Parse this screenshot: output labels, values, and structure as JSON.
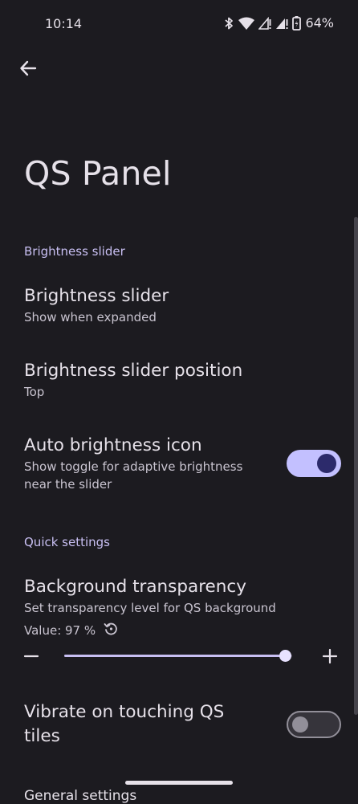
{
  "status_bar": {
    "time": "10:14",
    "battery": "64%",
    "icons": [
      "bluetooth-icon",
      "wifi-icon",
      "signal-icon",
      "signal-icon",
      "battery-charging-icon"
    ]
  },
  "header": {
    "back_icon": "arrow-left-icon",
    "title": "QS Panel"
  },
  "sections": {
    "brightness": {
      "header": "Brightness slider",
      "slider_pref": {
        "title": "Brightness slider",
        "summary": "Show when expanded"
      },
      "position_pref": {
        "title": "Brightness slider position",
        "summary": "Top"
      },
      "auto_icon_pref": {
        "title": "Auto brightness icon",
        "summary": "Show toggle for adaptive brightness near the slider",
        "enabled": true
      }
    },
    "quick_settings": {
      "header": "Quick settings",
      "transparency_pref": {
        "title": "Background transparency",
        "summary": "Set transparency level for QS background",
        "value_text": "Value: 97 %",
        "value": 97,
        "min": 0,
        "max": 100,
        "reset_icon": "reset-icon",
        "minus_icon": "minus-icon",
        "plus_icon": "plus-icon"
      },
      "vibrate_pref": {
        "title": "Vibrate on touching QS tiles",
        "enabled": false
      }
    },
    "cut_off_header": "General settings"
  },
  "colors": {
    "background": "#1c1b20",
    "accent": "#c8bff2",
    "switch_on_track": "#c3c0ff",
    "switch_on_thumb": "#2c2a6b"
  }
}
